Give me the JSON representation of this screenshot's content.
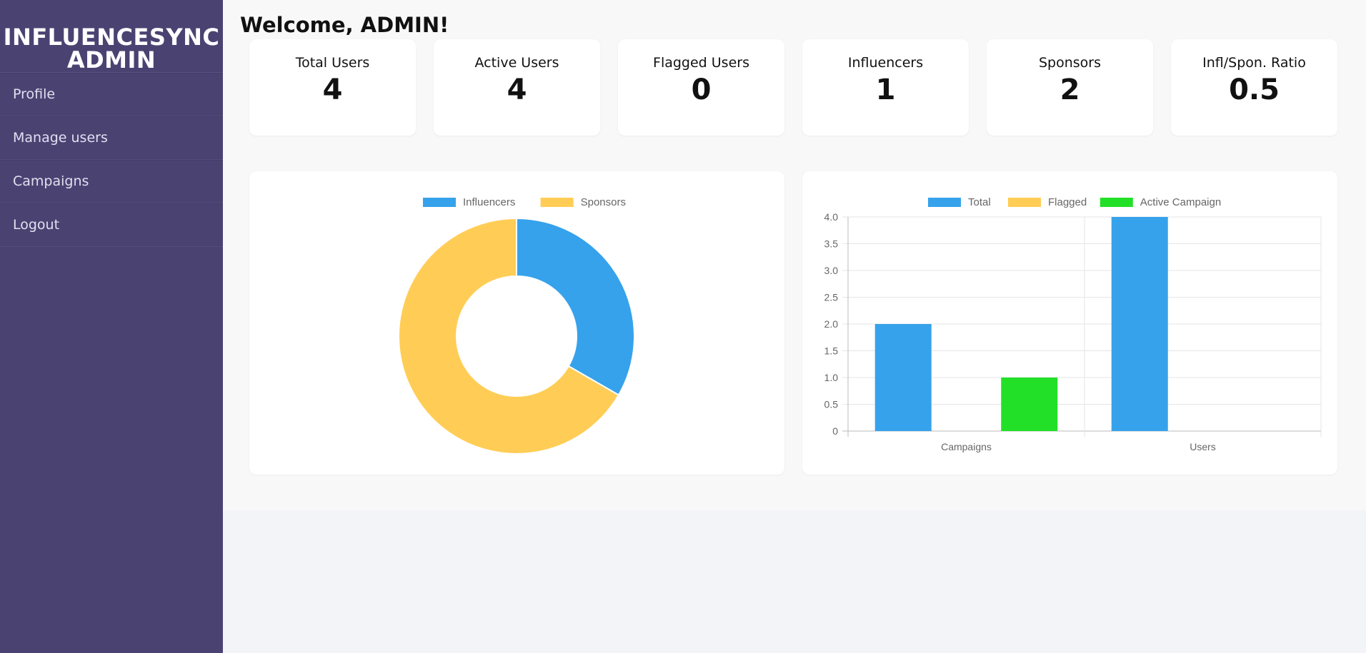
{
  "sidebar": {
    "brand": "INFLUENCESYNC ADMIN",
    "items": [
      {
        "label": "Profile"
      },
      {
        "label": "Manage users"
      },
      {
        "label": "Campaigns"
      },
      {
        "label": "Logout"
      }
    ]
  },
  "header": {
    "welcome": "Welcome, ADMIN!"
  },
  "stats": [
    {
      "label": "Total Users",
      "value": "4"
    },
    {
      "label": "Active Users",
      "value": "4"
    },
    {
      "label": "Flagged Users",
      "value": "0"
    },
    {
      "label": "Influencers",
      "value": "1"
    },
    {
      "label": "Sponsors",
      "value": "2"
    },
    {
      "label": "Infl/Spon. Ratio",
      "value": "0.5"
    }
  ],
  "colors": {
    "sidebar": "#4a4372",
    "blue": "#36a2eb",
    "yellow": "#ffcd56",
    "green": "#22e027"
  },
  "chart_data": [
    {
      "type": "pie",
      "variant": "doughnut",
      "title": "",
      "legend": "top",
      "labels": [
        "Influencers",
        "Sponsors"
      ],
      "values": [
        1,
        2
      ],
      "colors": [
        "#36a2eb",
        "#ffcd56"
      ]
    },
    {
      "type": "bar",
      "title": "",
      "legend": "top",
      "categories": [
        "Campaigns",
        "Users"
      ],
      "series": [
        {
          "name": "Total",
          "values": [
            2,
            4
          ],
          "color": "#36a2eb"
        },
        {
          "name": "Flagged",
          "values": [
            0,
            0
          ],
          "color": "#ffcd56"
        },
        {
          "name": "Active Campaign",
          "values": [
            1,
            0
          ],
          "color": "#22e027"
        }
      ],
      "ylim": [
        0,
        4
      ],
      "yticks": [
        "0",
        "0.5",
        "1.0",
        "1.5",
        "2.0",
        "2.5",
        "3.0",
        "3.5",
        "4.0"
      ],
      "grid": true
    }
  ]
}
